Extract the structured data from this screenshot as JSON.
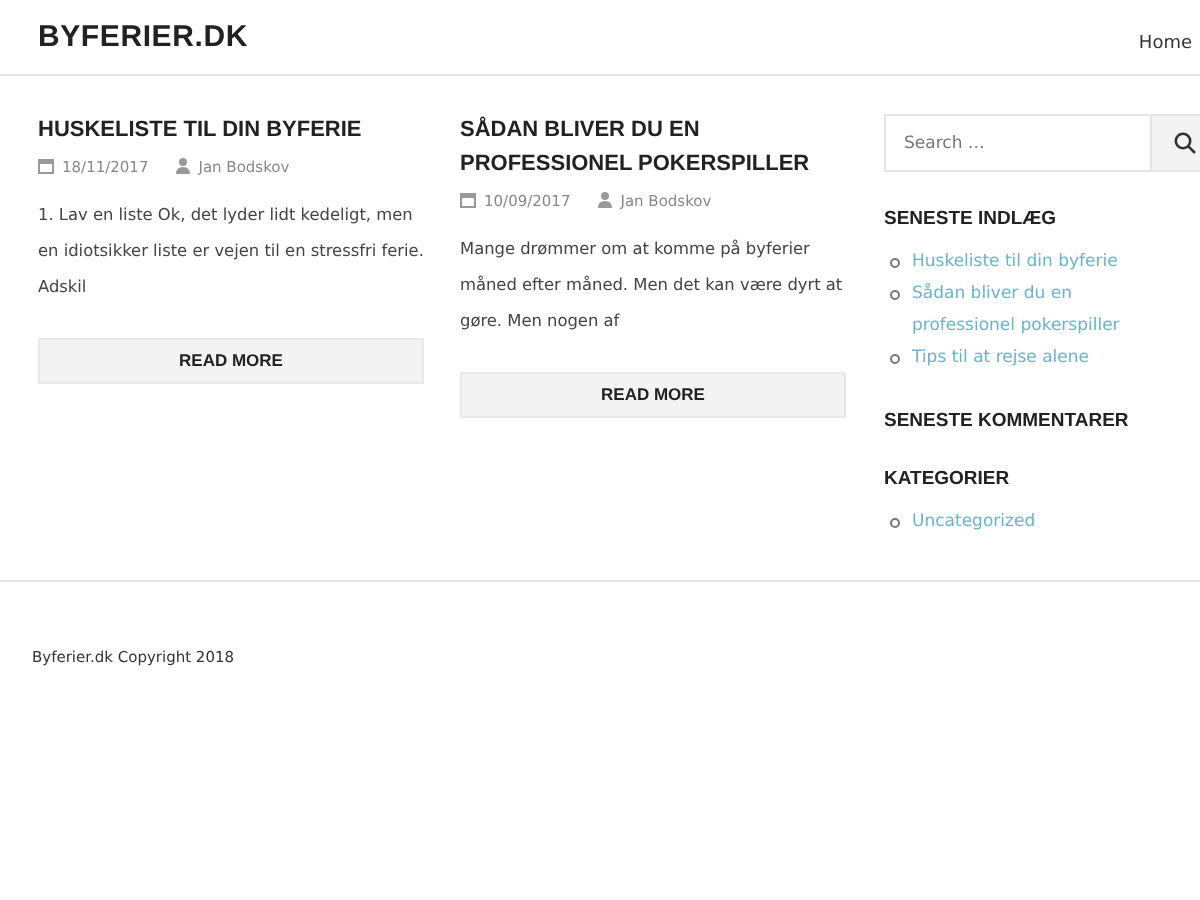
{
  "site": {
    "title": "BYFERIER.DK",
    "nav": [
      "Home"
    ]
  },
  "posts": [
    {
      "title": "HUSKELISTE TIL DIN BYFERIE",
      "date": "18/11/2017",
      "author": "Jan Bodskov",
      "excerpt": "1. Lav en liste Ok, det lyder lidt kedeligt, men en idiotsikker liste er vejen til en stressfri ferie. Adskil",
      "button": "READ MORE"
    },
    {
      "title": "SÅDAN BLIVER DU EN PROFESSIONEL POKERSPILLER",
      "date": "10/09/2017",
      "author": "Jan Bodskov",
      "excerpt": "Mange drømmer om at komme på byferier måned efter måned. Men det kan være dyrt at gøre. Men nogen af",
      "button": "READ MORE"
    }
  ],
  "sidebar": {
    "search": {
      "placeholder": "Search …"
    },
    "widgets": [
      {
        "title": "SENESTE INDLÆG",
        "items": [
          "Huskeliste til din byferie",
          "Sådan bliver du en professionel pokerspiller",
          "Tips til at rejse alene"
        ]
      },
      {
        "title": "SENESTE KOMMENTARER"
      },
      {
        "title": "KATEGORIER",
        "items": [
          "Uncategorized"
        ]
      }
    ]
  },
  "footer": {
    "copyright": "Byferier.dk Copyright 2018"
  }
}
